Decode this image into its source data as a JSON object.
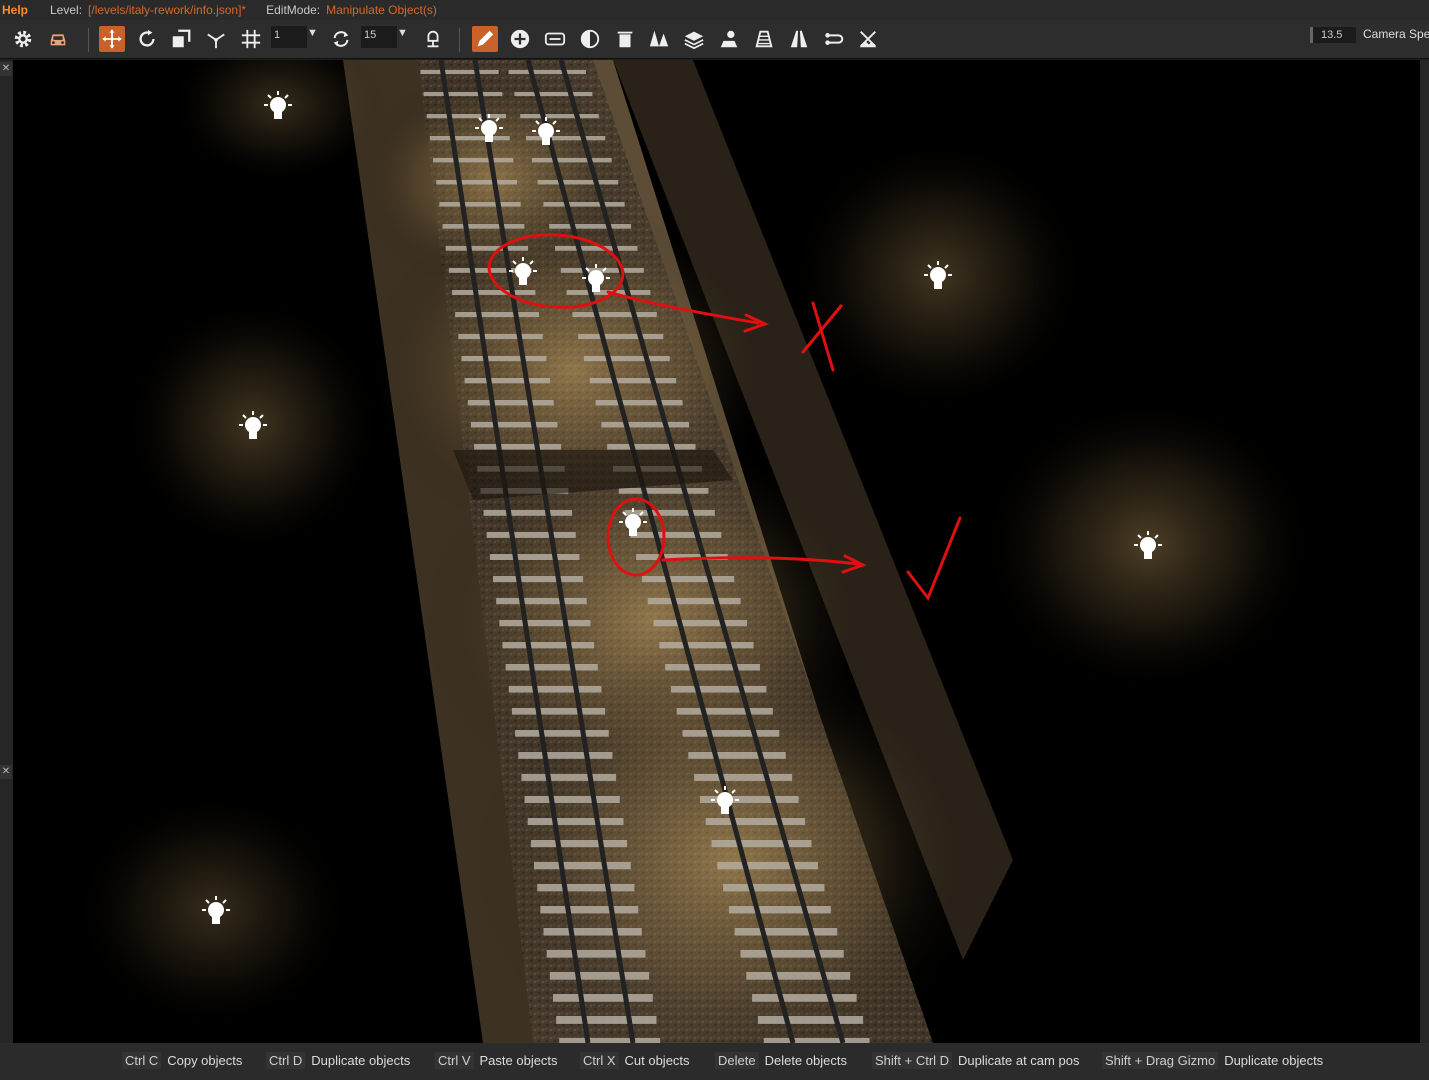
{
  "menubar": {
    "help": "Help",
    "level_label": "Level:",
    "level_value": "[/levels/italy-rework/info.json]*",
    "editmode_label": "EditMode:",
    "editmode_value": "Manipulate Object(s)"
  },
  "toolbar": {
    "snap_value": "1",
    "rotate_snap_value": "15",
    "speed_value": "13.5",
    "camera_speed_label": "Camera Spe"
  },
  "icons": [
    "gear-icon",
    "car-icon",
    "move-icon",
    "rotate-icon",
    "scale-icon",
    "axis-icon",
    "grid-snap-icon",
    "rotation-snap-icon",
    "terrain-snap-icon",
    "pencil-icon",
    "add-icon",
    "link-icon",
    "circle-icon",
    "trash-icon",
    "forest-icon",
    "layers-icon",
    "light-icon",
    "water-icon",
    "road-icon",
    "connect-icon",
    "terrain-icon"
  ],
  "statusbar": {
    "hints": [
      {
        "key": "Ctrl C",
        "action": "Copy objects"
      },
      {
        "key": "Ctrl D",
        "action": "Duplicate objects"
      },
      {
        "key": "Ctrl V",
        "action": "Paste objects"
      },
      {
        "key": "Ctrl X",
        "action": "Cut objects"
      },
      {
        "key": "Delete",
        "action": "Delete objects"
      },
      {
        "key": "Shift + Ctrl D",
        "action": "Duplicate at cam pos"
      },
      {
        "key": "Shift + Drag Gizmo",
        "action": "Duplicate objects"
      }
    ]
  },
  "colors": {
    "accent": "#c8622a",
    "annotation": "#e01010",
    "light_glow": "#c9a564"
  }
}
